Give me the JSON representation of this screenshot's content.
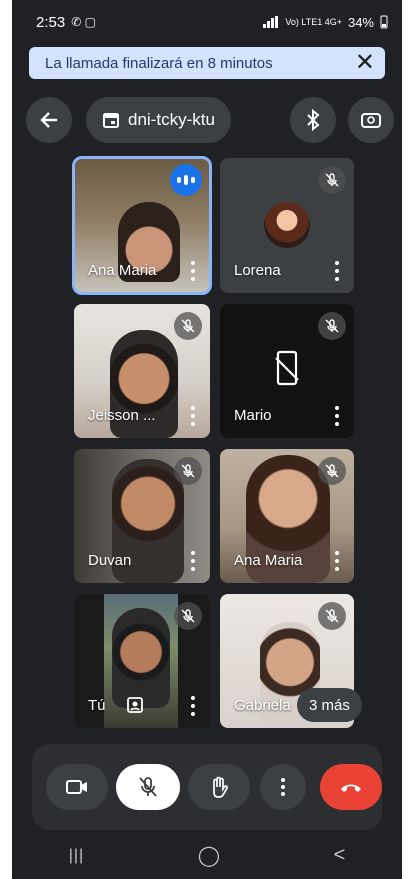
{
  "status": {
    "time": "2:53",
    "left_icons": "✆ ▢",
    "network": "Vo) LTE1 4G+",
    "battery": "34%"
  },
  "banner": {
    "text": "La llamada finalizará en 8 minutos",
    "close": "✕"
  },
  "header": {
    "back": "←",
    "meeting_code": "dni-tcky-ktu",
    "bluetooth": "⧖",
    "switch_camera": "⟲"
  },
  "participants": [
    {
      "name": "Ana Maria",
      "muted": false,
      "speaking": true
    },
    {
      "name": "Lorena",
      "muted": true
    },
    {
      "name": "Jeisson ...",
      "muted": true
    },
    {
      "name": "Mario",
      "muted": true,
      "camera_off": true
    },
    {
      "name": "Duvan",
      "muted": true
    },
    {
      "name": "Ana Maria",
      "muted": true
    },
    {
      "name": "Tú",
      "muted": true
    },
    {
      "name": "Gabriela",
      "muted": true
    }
  ],
  "more_participants": "3 más",
  "colors": {
    "background": "#202124",
    "tile": "#3c4043",
    "accent": "#1a73e8",
    "end_call": "#ea4335",
    "banner": "#d3e3fd"
  },
  "nav": {
    "recents": "|||",
    "home": "◯",
    "back": "<"
  }
}
